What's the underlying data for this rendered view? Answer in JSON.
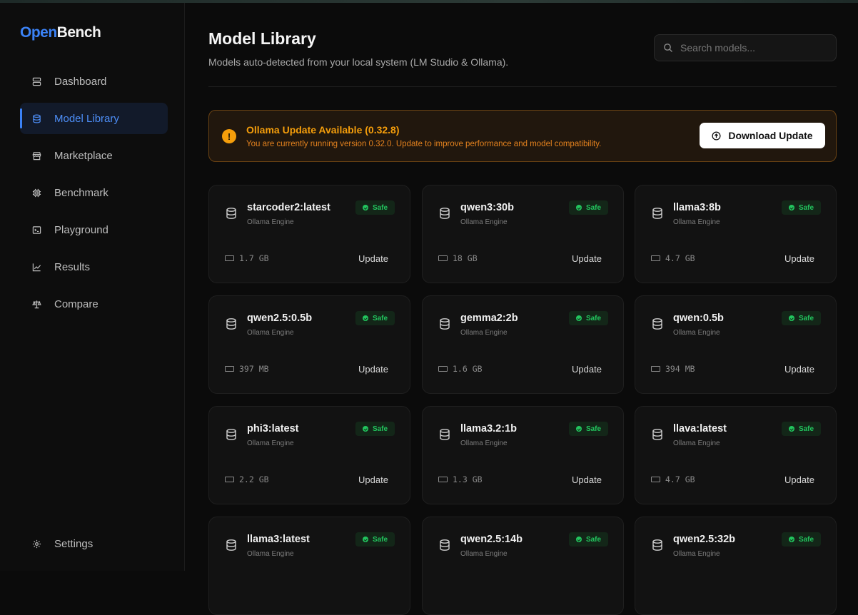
{
  "app": {
    "logo_part1": "Open",
    "logo_part2": "Bench"
  },
  "sidebar": {
    "items": [
      {
        "label": "Dashboard",
        "icon": "dashboard-icon",
        "active": false
      },
      {
        "label": "Model Library",
        "icon": "database-icon",
        "active": true
      },
      {
        "label": "Marketplace",
        "icon": "store-icon",
        "active": false
      },
      {
        "label": "Benchmark",
        "icon": "cpu-icon",
        "active": false
      },
      {
        "label": "Playground",
        "icon": "terminal-icon",
        "active": false
      },
      {
        "label": "Results",
        "icon": "chart-icon",
        "active": false
      },
      {
        "label": "Compare",
        "icon": "scale-icon",
        "active": false
      }
    ],
    "settings_label": "Settings"
  },
  "header": {
    "title": "Model Library",
    "subtitle": "Models auto-detected from your local system (LM Studio & Ollama).",
    "search_placeholder": "Search models..."
  },
  "alert": {
    "title": "Ollama Update Available (0.32.8)",
    "text": "You are currently running version 0.32.0. Update to improve performance and model compatibility.",
    "button": "Download Update"
  },
  "models": [
    {
      "name": "starcoder2:latest",
      "engine": "Ollama Engine",
      "badge": "Safe",
      "size": "1.7 GB",
      "action": "Update"
    },
    {
      "name": "qwen3:30b",
      "engine": "Ollama Engine",
      "badge": "Safe",
      "size": "18 GB",
      "action": "Update"
    },
    {
      "name": "llama3:8b",
      "engine": "Ollama Engine",
      "badge": "Safe",
      "size": "4.7 GB",
      "action": "Update"
    },
    {
      "name": "qwen2.5:0.5b",
      "engine": "Ollama Engine",
      "badge": "Safe",
      "size": "397 MB",
      "action": "Update"
    },
    {
      "name": "gemma2:2b",
      "engine": "Ollama Engine",
      "badge": "Safe",
      "size": "1.6 GB",
      "action": "Update"
    },
    {
      "name": "qwen:0.5b",
      "engine": "Ollama Engine",
      "badge": "Safe",
      "size": "394 MB",
      "action": "Update"
    },
    {
      "name": "phi3:latest",
      "engine": "Ollama Engine",
      "badge": "Safe",
      "size": "2.2 GB",
      "action": "Update"
    },
    {
      "name": "llama3.2:1b",
      "engine": "Ollama Engine",
      "badge": "Safe",
      "size": "1.3 GB",
      "action": "Update"
    },
    {
      "name": "llava:latest",
      "engine": "Ollama Engine",
      "badge": "Safe",
      "size": "4.7 GB",
      "action": "Update"
    },
    {
      "name": "llama3:latest",
      "engine": "Ollama Engine",
      "badge": "Safe",
      "size": "",
      "action": ""
    },
    {
      "name": "qwen2.5:14b",
      "engine": "Ollama Engine",
      "badge": "Safe",
      "size": "",
      "action": ""
    },
    {
      "name": "qwen2.5:32b",
      "engine": "Ollama Engine",
      "badge": "Safe",
      "size": "",
      "action": ""
    }
  ],
  "colors": {
    "accent": "#3b82f6",
    "warning": "#f59e0b",
    "safe": "#22c55e",
    "background": "#0b0b0b"
  }
}
